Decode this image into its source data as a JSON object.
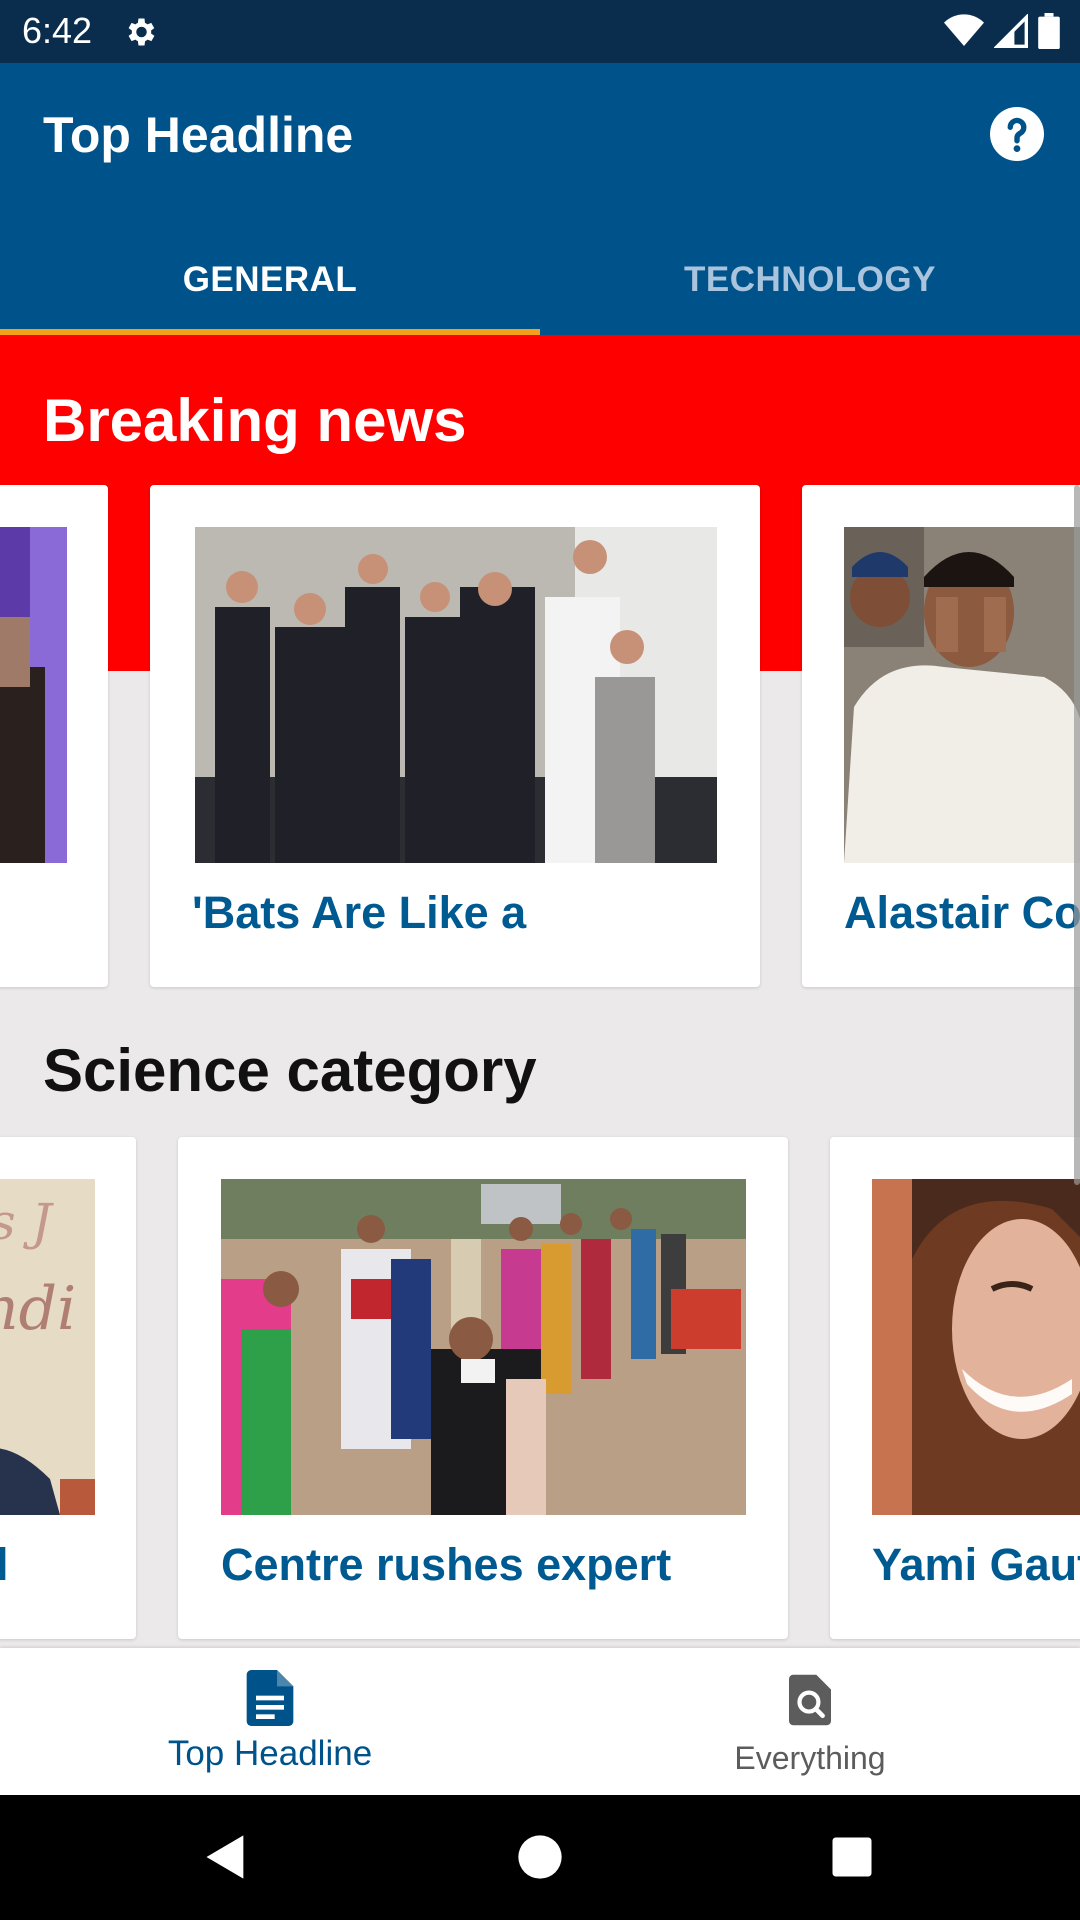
{
  "status_bar": {
    "time": "6:42",
    "icons": [
      "gear-icon",
      "wifi-icon",
      "signal-icon",
      "battery-icon"
    ]
  },
  "app_bar": {
    "title": "Top Headline",
    "help_icon": "help-circle-icon",
    "tabs": [
      {
        "label": "GENERAL",
        "active": true
      },
      {
        "label": "TECHNOLOGY",
        "active": false
      }
    ],
    "indicator_color": "#f6a019",
    "background_color": "#00538a"
  },
  "sections": [
    {
      "title": "Breaking news",
      "accent_color": "#fe0000",
      "cards": [
        {
          "title": "",
          "image": "person in suit partial"
        },
        {
          "title": "'Bats Are Like a",
          "image": "group photo of commentators in suits"
        },
        {
          "title": "Alastair Coo",
          "image": "cricketer in India sweater covering face"
        }
      ]
    },
    {
      "title": "Science category",
      "cards": [
        {
          "title": "l",
          "image": "person in front of banner partial"
        },
        {
          "title": "Centre rushes expert",
          "image": "queue of people in masks"
        },
        {
          "title": "Yami Gaut",
          "image": "smiling woman portrait"
        }
      ]
    }
  ],
  "bottom_nav": [
    {
      "label": "Top Headline",
      "icon": "document-icon",
      "active": true
    },
    {
      "label": "Everything",
      "icon": "search-file-icon",
      "active": false
    }
  ],
  "system_nav": [
    "back-icon",
    "home-icon",
    "recents-icon"
  ]
}
